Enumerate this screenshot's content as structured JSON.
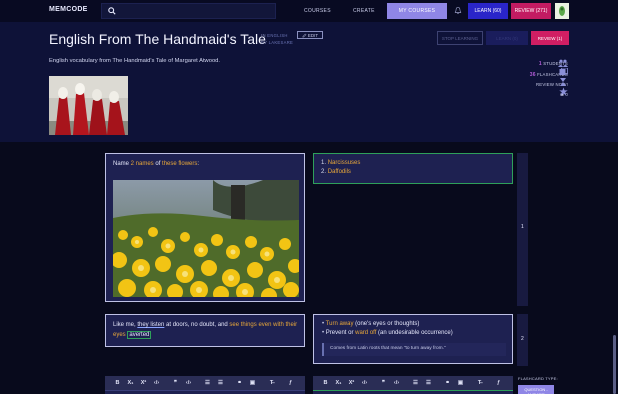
{
  "nav": {
    "logo": "MEMCODE",
    "courses": "COURSES",
    "create": "CREATE",
    "my_courses": "MY COURSES",
    "learn": "LEARN (60)",
    "review": "REVIEW (271)"
  },
  "course": {
    "title": "English From The Handmaid's Tale",
    "in_label": "IN",
    "category": "ENGLISH",
    "by_label": "BY",
    "author": "LAKESARE",
    "edit": "EDIT",
    "stop_learning": "STOP LEARNING",
    "learn": "LEARN (0)",
    "review": "REVIEW (1)",
    "description": "English vocabulary from The Handmaid's Tale of Margaret Atwood."
  },
  "stats": {
    "students_count": "1",
    "students_label": "STUDENTS",
    "flashcards_count": "36",
    "flashcards_label": "FLASHCARDS",
    "review_now": "REVIEW NOW!",
    "rating": "0"
  },
  "cards": [
    {
      "index": "1",
      "question_prefix": "Name ",
      "question_hl1": "2 names",
      "question_mid": " of ",
      "question_hl2": "these flowers",
      "question_suffix": ":",
      "answers": [
        "Narcissuses",
        "Daffodils"
      ],
      "answer_numbers": [
        "1.",
        "2."
      ]
    },
    {
      "index": "2",
      "q_part1": "Like me, ",
      "q_ul": "they listen",
      "q_part2": " at doors, no doubt, and ",
      "q_hl": "see things even with their eyes",
      "q_part3": " ",
      "q_boxed": "averted",
      "a_item1_hl": "Turn away",
      "a_item1_rest": " (one's eyes or thoughts)",
      "a_item2_pre": "Prevent or ",
      "a_item2_hl": "ward off",
      "a_item2_rest": " (an undesirable occurrence)",
      "note": "Comes from Latin roots that mean \"to turn away from.\""
    }
  ],
  "editor": {
    "flashcard_type_label": "FLASHCARD TYPE:",
    "flashcard_type_value": "QUESTION - ANSWER"
  },
  "colors": {
    "accent": "#8f86e6",
    "learn": "#2a25c9",
    "review": "#c21b62",
    "highlight": "#e7a73a",
    "answer_border": "#2ea05a"
  }
}
